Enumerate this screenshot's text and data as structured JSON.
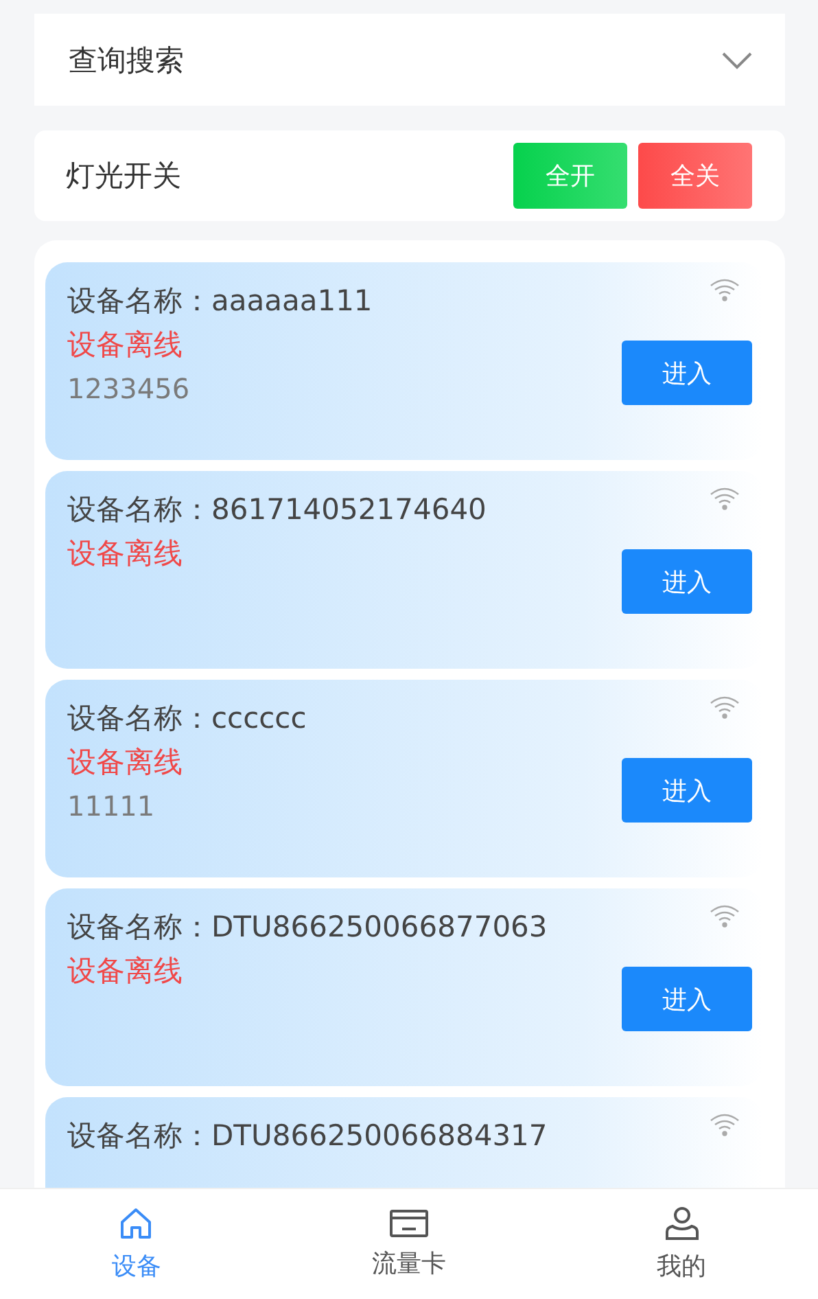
{
  "search_panel": {
    "title": "查询搜索",
    "expanded": false
  },
  "light_switch": {
    "title": "灯光开关",
    "buttons": [
      {
        "label": "全开",
        "kind": "on"
      },
      {
        "label": "全关",
        "kind": "off"
      }
    ]
  },
  "devices": [
    {
      "name_label": "设备名称：",
      "name": "aaaaaa111",
      "status": "设备离线",
      "online": false,
      "note": "1233456",
      "button": "进入"
    },
    {
      "name_label": "设备名称：",
      "name": "861714052174640",
      "status": "设备离线",
      "online": false,
      "button": "进入"
    },
    {
      "name_label": "设备名称：",
      "name": "cccccc",
      "status": "设备离线",
      "online": false,
      "note": "11111",
      "button": "进入"
    },
    {
      "name_label": "设备名称：",
      "name": "DTU866250066877063",
      "status": "设备离线",
      "online": false,
      "button": "进入"
    },
    {
      "name_label": "设备名称：",
      "name": "DTU866250066884317",
      "online": false
    }
  ],
  "tab_bar": [
    {
      "label": "设备",
      "kind": "home",
      "selected": true
    },
    {
      "label": "流量卡",
      "kind": "card",
      "selected": false
    },
    {
      "label": "我的",
      "kind": "user",
      "selected": false
    }
  ]
}
